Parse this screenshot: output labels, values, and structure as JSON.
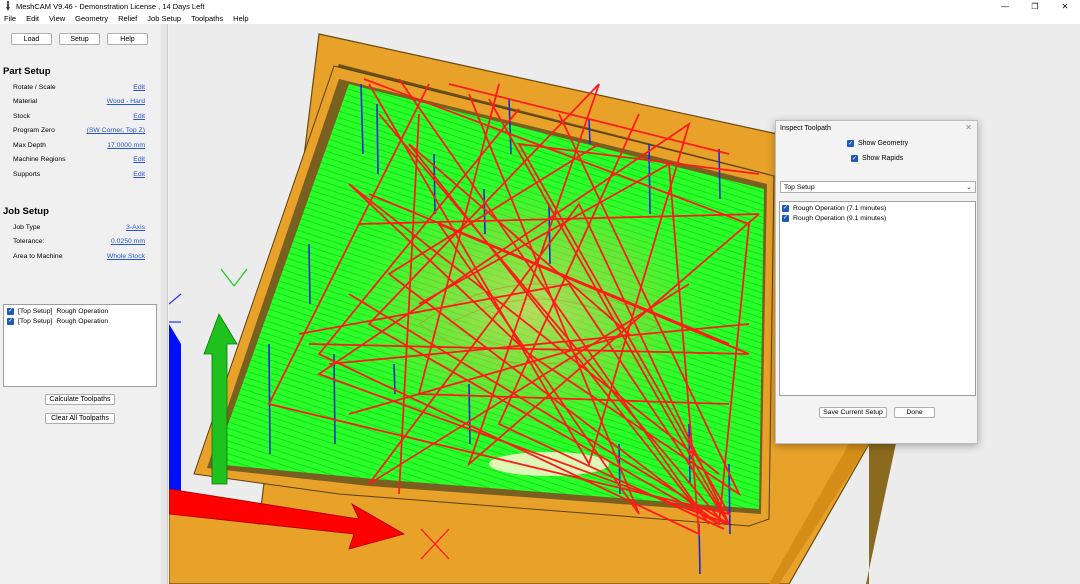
{
  "window": {
    "title": "MeshCAM V9.46 - Demonstration License , 14 Days Left",
    "minimize": "—",
    "maximize": "❐",
    "close": "✕"
  },
  "menu": [
    "File",
    "Edit",
    "View",
    "Geometry",
    "Relief",
    "Job Setup",
    "Toolpaths",
    "Help"
  ],
  "toolbar": {
    "load": "Load",
    "setup": "Setup",
    "help": "Help"
  },
  "part_setup": {
    "title": "Part Setup",
    "rows": [
      {
        "label": "Rotate / Scale",
        "value": "Edit"
      },
      {
        "label": "Material",
        "value": "Wood - Hard"
      },
      {
        "label": "Stock",
        "value": "Edit"
      },
      {
        "label": "Program Zero",
        "value": "(SW Corner, Top Z)"
      },
      {
        "label": "Max Depth",
        "value": "17.0000 mm"
      },
      {
        "label": "Machine Regions",
        "value": "Edit"
      },
      {
        "label": "Supports",
        "value": "Edit"
      }
    ]
  },
  "job_setup": {
    "title": "Job Setup",
    "rows": [
      {
        "label": "Job Type",
        "value": "3-Axis"
      },
      {
        "label": "Tolerance:",
        "value": "0.0250 mm"
      },
      {
        "label": "Area to Machine",
        "value": "Whole Stock"
      }
    ]
  },
  "operations": [
    {
      "setup": "[Top Setup]",
      "name": "Rough Operation",
      "checked": true
    },
    {
      "setup": "[Top Setup]",
      "name": "Rough Operation",
      "checked": true
    }
  ],
  "actions": {
    "calculate": "Calculate Toolpaths",
    "clear": "Clear All Toolpaths"
  },
  "inspect_dialog": {
    "title": "Inspect Toolpath",
    "close": "✕",
    "show_geometry": "Show Geometry",
    "show_rapids": "Show Rapids",
    "setup_select": "Top Setup",
    "items": [
      "Rough Operation (7.1 minutes)",
      "Rough Operation (9.1 minutes)"
    ],
    "save_button": "Save Current Setup",
    "done_button": "Done"
  },
  "colors": {
    "stock_outer": "#e8a22a",
    "stock_dark": "#7a5a10",
    "toolpath_green": "#00ff00",
    "plunge_blue": "#1a2bd6",
    "rapid_red": "#ff1a1a",
    "axis_red": "#ff0000",
    "axis_green": "#1fc11f",
    "axis_blue": "#0010ff",
    "link": "#2a55c8"
  }
}
